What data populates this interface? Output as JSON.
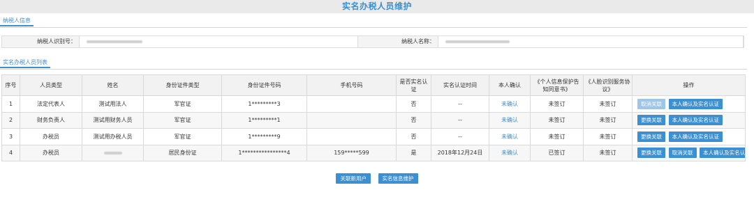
{
  "title": "实名办税人员维护",
  "sections": {
    "taxpayer_info": "纳税人信息",
    "staff_list": "实名办税人员列表"
  },
  "info": {
    "id_label": "纳税人识别号：",
    "name_label": "纳税人名称："
  },
  "table": {
    "headers": [
      "序号",
      "人员类型",
      "姓名",
      "身份证件类型",
      "身份证件号码",
      "手机号码",
      "是否实名认证",
      "实名认证时间",
      "本人确认",
      "《个人信息保护告知同意书》",
      "《人脸识别服务协议》",
      "操作"
    ],
    "rows": [
      {
        "no": "1",
        "type": "法定代表人",
        "name": "测试用法人",
        "id_type": "军官证",
        "id_no": "1*********3",
        "phone": "",
        "verified": "否",
        "verify_time": "--",
        "confirm": "未确认",
        "privacy": "未签订",
        "face": "未签订"
      },
      {
        "no": "2",
        "type": "财务负责人",
        "name": "测试用财务人员",
        "id_type": "军官证",
        "id_no": "1*********1",
        "phone": "",
        "verified": "否",
        "verify_time": "--",
        "confirm": "未确认",
        "privacy": "未签订",
        "face": "未签订"
      },
      {
        "no": "3",
        "type": "办税员",
        "name": "测试用办税人员",
        "id_type": "军官证",
        "id_no": "1*********9",
        "phone": "",
        "verified": "否",
        "verify_time": "--",
        "confirm": "未确认",
        "privacy": "未签订",
        "face": "未签订"
      },
      {
        "no": "4",
        "type": "办税员",
        "name": "",
        "id_type": "居民身份证",
        "id_no": "1****************4",
        "phone": "159*****599",
        "verified": "是",
        "verify_time": "2018年12月24日",
        "confirm": "未确认",
        "privacy": "已签订",
        "face": "未签订"
      }
    ]
  },
  "buttons": {
    "cancel_link": "取消关联",
    "change_link": "更换关联",
    "confirm_verify": "本人确认及实名认证",
    "link_new_user": "关联新用户",
    "info_maintain": "实名信息维护"
  },
  "colors": {
    "accent": "#3c8fd0",
    "disabled": "#9ec6e8"
  }
}
